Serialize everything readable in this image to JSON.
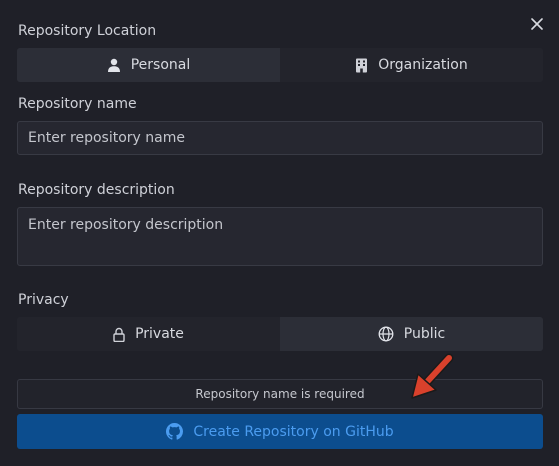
{
  "dialog": {
    "close_icon": "close-icon",
    "location": {
      "label": "Repository Location",
      "options": [
        {
          "label": "Personal",
          "icon": "user-icon",
          "selected": true
        },
        {
          "label": "Organization",
          "icon": "building-icon",
          "selected": false
        }
      ]
    },
    "name": {
      "label": "Repository name",
      "placeholder": "Enter repository name",
      "value": ""
    },
    "description": {
      "label": "Repository description",
      "placeholder": "Enter repository description",
      "value": ""
    },
    "privacy": {
      "label": "Privacy",
      "options": [
        {
          "label": "Private",
          "icon": "lock-icon",
          "selected": false
        },
        {
          "label": "Public",
          "icon": "globe-icon",
          "selected": true
        }
      ]
    },
    "error_message": "Repository name is required",
    "create_button": {
      "label": "Create Repository on GitHub",
      "icon": "github-icon"
    }
  },
  "colors": {
    "background": "#1f2028",
    "accent_button": "#0c4d8e",
    "accent_text": "#4b9cf0",
    "annotation_arrow": "#d9412c"
  }
}
